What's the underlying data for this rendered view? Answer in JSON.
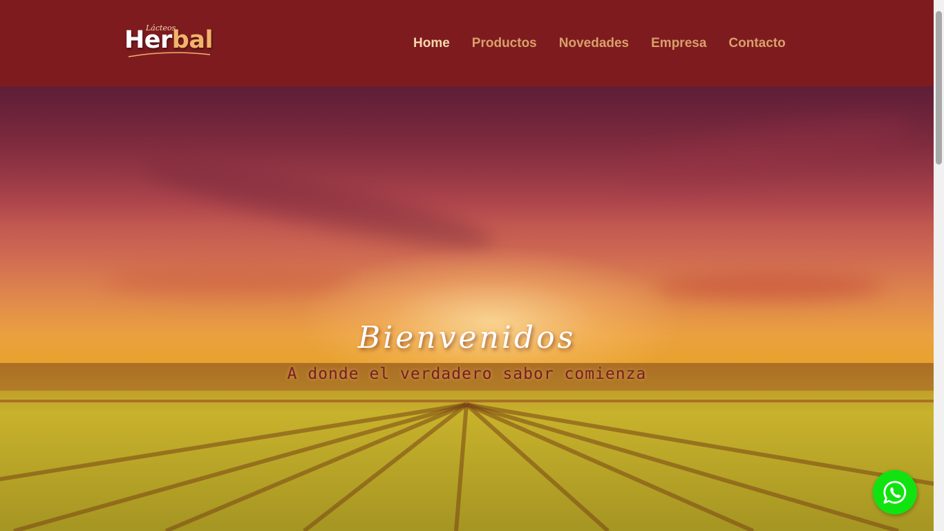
{
  "brand": {
    "logo_small": "Lácteos",
    "logo_main_a": "Her",
    "logo_main_b": "bal",
    "header_color": "#7e1b1f"
  },
  "nav": {
    "items": [
      {
        "label": "Home",
        "active": true
      },
      {
        "label": "Productos",
        "active": false
      },
      {
        "label": "Novedades",
        "active": false
      },
      {
        "label": "Empresa",
        "active": false
      },
      {
        "label": "Contacto",
        "active": false
      }
    ]
  },
  "hero": {
    "title": "Bienvenidos",
    "subtitle": "A donde el verdadero sabor comienza"
  },
  "floating": {
    "whatsapp_icon": "whatsapp-icon",
    "whatsapp_color": "#11e311"
  }
}
